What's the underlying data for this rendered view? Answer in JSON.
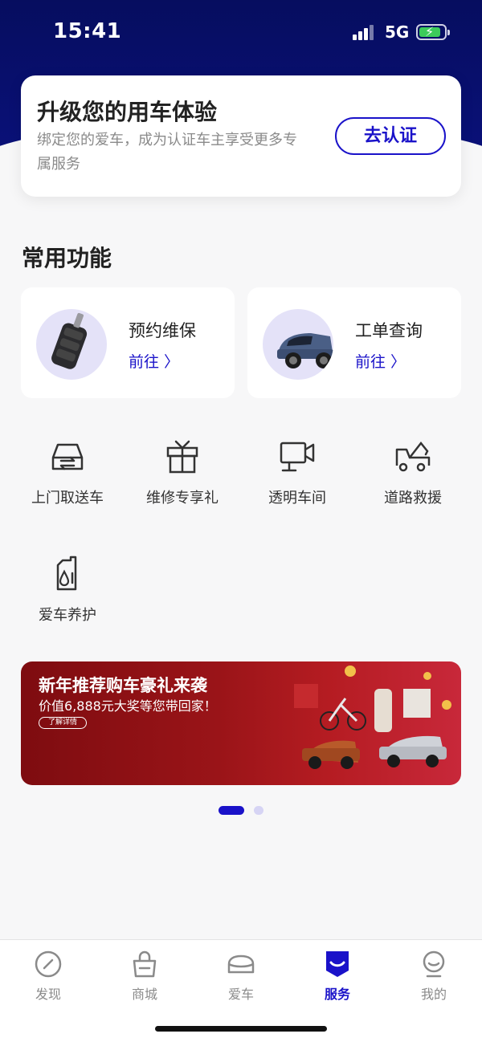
{
  "status_bar": {
    "time": "15:41",
    "network": "5G",
    "battery_charging": true
  },
  "upgrade_card": {
    "title": "升级您的用车体验",
    "description": "绑定您的爱车，成为认证车主享受更多专属服务",
    "button_label": "去认证"
  },
  "section": {
    "title": "常用功能"
  },
  "feature_cards": [
    {
      "name": "预约维保",
      "link": "前往 〉",
      "icon": "car-key"
    },
    {
      "name": "工单查询",
      "link": "前往 〉",
      "icon": "car-photo"
    }
  ],
  "shortcuts": [
    {
      "label": "上门取送车",
      "icon": "car-swap-icon"
    },
    {
      "label": "维修专享礼",
      "icon": "gift-icon"
    },
    {
      "label": "透明车间",
      "icon": "camera-icon"
    },
    {
      "label": "道路救援",
      "icon": "tow-truck-icon"
    },
    {
      "label": "爱车养护",
      "icon": "oil-can-icon"
    }
  ],
  "banner": {
    "title": "新年推荐购车豪礼来袭",
    "subtitle": "价值6,888元大奖等您带回家！",
    "button_label": "了解详情"
  },
  "carousel": {
    "total": 2,
    "active": 1
  },
  "tabbar": [
    {
      "label": "发现",
      "icon": "compass-icon",
      "active": false
    },
    {
      "label": "商城",
      "icon": "shopping-bag-icon",
      "active": false
    },
    {
      "label": "爱车",
      "icon": "car-icon",
      "active": false
    },
    {
      "label": "服务",
      "icon": "service-icon",
      "active": true
    },
    {
      "label": "我的",
      "icon": "profile-icon",
      "active": false
    }
  ],
  "colors": {
    "brand": "#1a12c9",
    "header_bg": "#060d5f",
    "banner_red": "#9a1418"
  }
}
